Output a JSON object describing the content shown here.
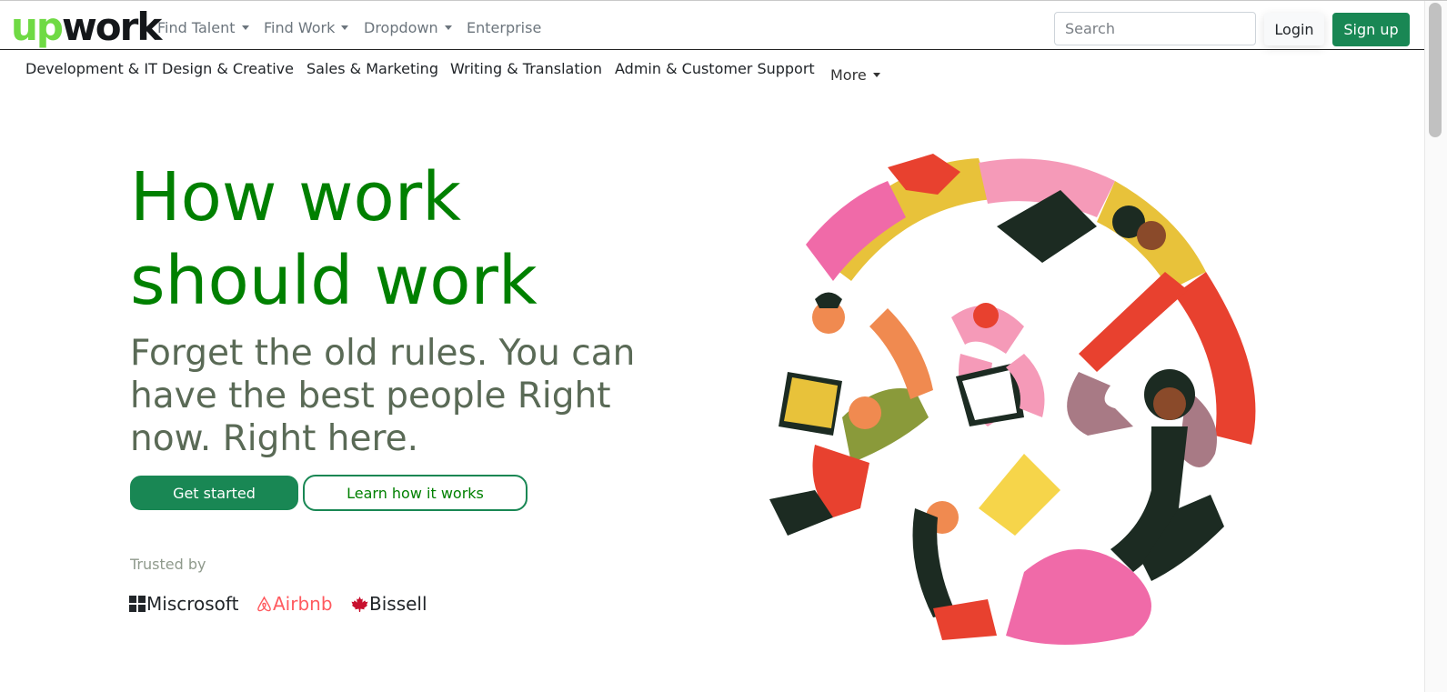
{
  "brand": {
    "logo_up": "up",
    "logo_work": "work",
    "accent": "#6fda44"
  },
  "nav": {
    "items": [
      {
        "label": "Find Talent",
        "dropdown": true
      },
      {
        "label": "Find Work",
        "dropdown": true
      },
      {
        "label": "Dropdown",
        "dropdown": true
      },
      {
        "label": "Enterprise",
        "dropdown": false
      }
    ],
    "search_placeholder": "Search",
    "login_label": "Login",
    "signup_label": "Sign up"
  },
  "categories": [
    "Development & IT",
    "Design & Creative",
    "Sales & Marketing",
    "Writing & Translation",
    "Admin & Customer Support"
  ],
  "more_label": "More",
  "hero": {
    "headline_line1": "How work",
    "headline_line2": "should work",
    "sub_line1": "Forget the old rules. You can",
    "sub_line2": "have the best people Right",
    "sub_line3": "now. Right here.",
    "cta_primary": "Get started",
    "cta_secondary": "Learn how it works",
    "headline_color": "#008000",
    "button_color": "#198754"
  },
  "trusted": {
    "label": "Trusted by",
    "brands": [
      {
        "name": "Miscrosoft",
        "icon": "windows-icon",
        "color": "#212529"
      },
      {
        "name": "Airbnb",
        "icon": "airbnb-icon",
        "color": "#ff5a5f"
      },
      {
        "name": "Bissell",
        "icon": "maple-leaf-icon",
        "color": "#212529"
      }
    ]
  }
}
